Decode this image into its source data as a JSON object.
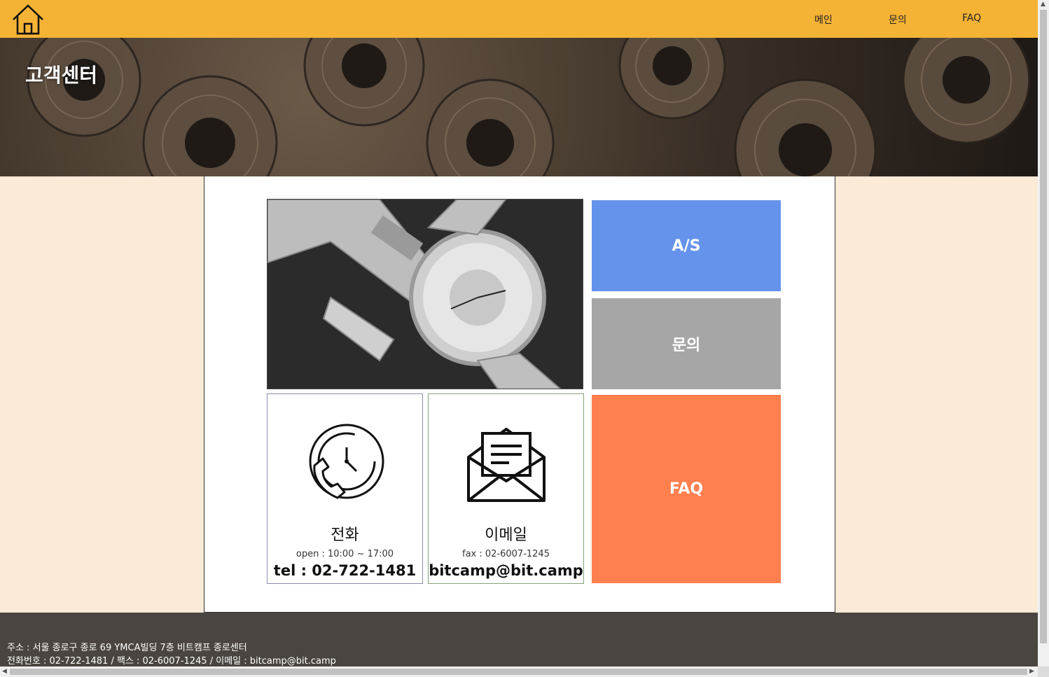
{
  "header": {
    "home_icon": "home-icon",
    "nav": [
      "메인",
      "문의",
      "FAQ"
    ]
  },
  "hero": {
    "title": "고객센터"
  },
  "tiles": {
    "as": "A/S",
    "inquiry": "문의",
    "faq": "FAQ"
  },
  "phone_card": {
    "icon": "phone-clock-icon",
    "title": "전화",
    "sub": "open : 10:00 ~ 17:00",
    "main": "tel : 02-722-1481"
  },
  "email_card": {
    "icon": "envelope-icon",
    "title": "이메일",
    "sub": "fax : 02-6007-1245",
    "main": "bitcamp@bit.camp"
  },
  "footer": {
    "address": "주소 : 서울 종로구 종로 69 YMCA빌딩 7층 비트캠프 종로센터",
    "contact": "전화번호 : 02-722-1481 / 팩스 : 02-6007-1245 / 이메일 : bitcamp@bit.camp"
  },
  "colors": {
    "topbar": "#f5b335",
    "page_bg": "#fbead6",
    "as_tile": "#6593ec",
    "inquiry_tile": "#a6a6a6",
    "faq_tile": "#ff7f4e",
    "footer": "#4a4540"
  }
}
